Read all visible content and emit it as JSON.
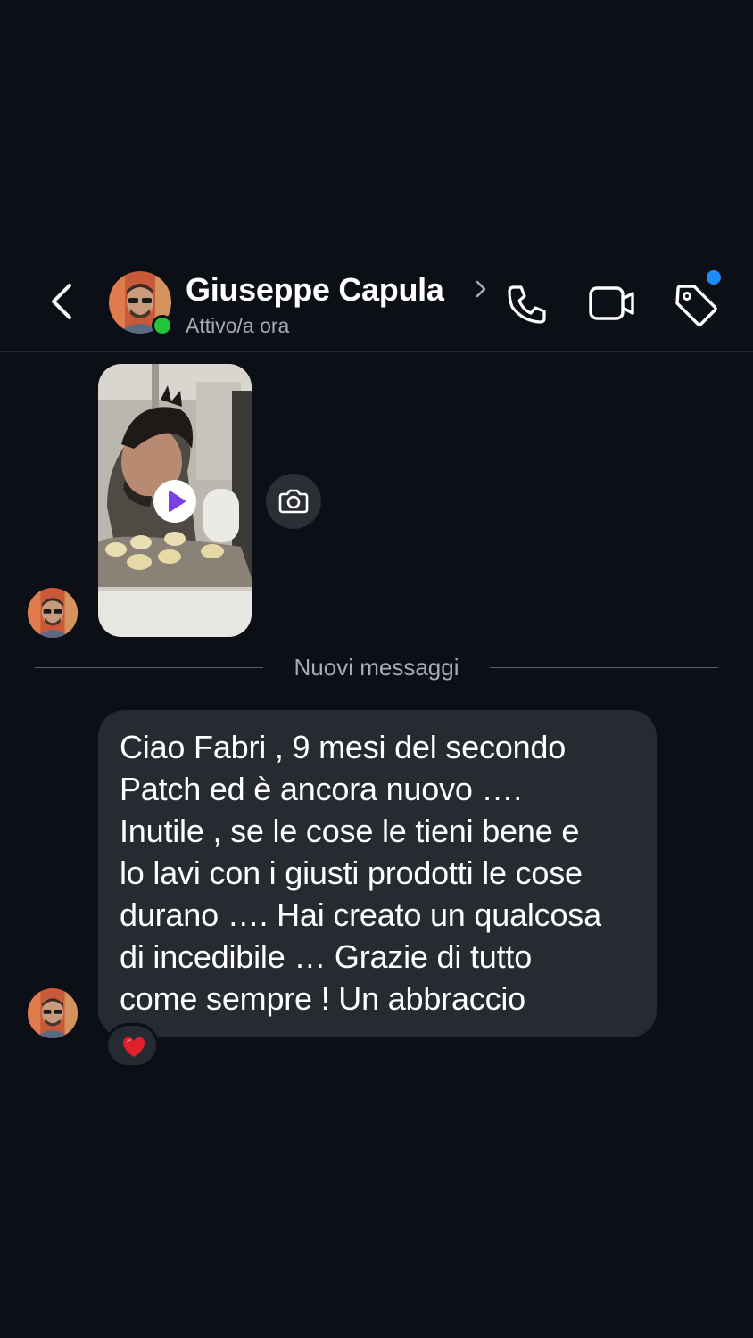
{
  "header": {
    "contact_name": "Giuseppe Capula",
    "status": "Attivo/a ora",
    "online": true,
    "notification_dot_color": "#1d8cf8",
    "icons": {
      "back": "chevron-left-icon",
      "call": "phone-icon",
      "video": "video-camera-icon",
      "tag": "tag-icon"
    }
  },
  "conversation": {
    "media_message": {
      "type": "video",
      "icon": "play-icon",
      "accent_color": "#7b3fe4",
      "side_action_icon": "camera-icon"
    },
    "divider_label": "Nuovi messaggi",
    "text_message": {
      "lines": [
        "Ciao Fabri , 9 mesi del secondo",
        "Patch ed è ancora nuovo ….",
        "Inutile , se le cose le tieni bene e",
        "lo lavi con i giusti prodotti le cose",
        "durano …. Hai creato un qualcosa",
        "di incedibile … Grazie di tutto",
        "come sempre ! Un abbraccio"
      ],
      "reaction": "heart-icon",
      "reaction_color": "#e0202a"
    }
  },
  "colors": {
    "background": "#0c0f16",
    "bubble": "#262a31",
    "online": "#22c43b"
  }
}
